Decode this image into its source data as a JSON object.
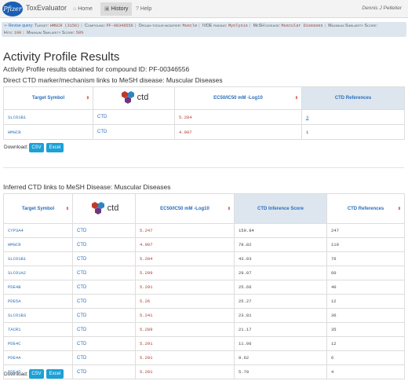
{
  "navbar": {
    "logo_text": "Pfizer",
    "brand": "ToxEvaluator",
    "items": [
      {
        "icon": "home-icon",
        "glyph": "⌂",
        "label": "Home"
      },
      {
        "icon": "history-icon",
        "glyph": "▣",
        "label": "History"
      },
      {
        "icon": "help-icon",
        "glyph": "?",
        "label": "Help"
      }
    ],
    "user": "Dennis J Pelletier"
  },
  "query": {
    "revise_label": "Revise query:",
    "target_key": "Target:",
    "target_value": "HMGCR (3156)",
    "compound_key": "Compound:",
    "compound_value": "PF-00346556",
    "organ_key": "Organ-tissue-modifier:",
    "organ_value": "Muscle",
    "ivde_key": "IVDE finding:",
    "ivde_value": "Myolysis",
    "mesh_key": "MeSH disease:",
    "mesh_value": "Muscular Diseases",
    "maxsim_key": "Maximum Similarity Score:",
    "hits_key": "Hits:",
    "hits_value": "100",
    "minsim_key": "Minimum Similarity Score:",
    "minsim_value": "50%"
  },
  "page": {
    "title": "Activity Profile Results",
    "subtitle": "Activity Profile results obtained for compound ID: PF-00346556",
    "direct_heading": "Direct CTD marker/mechanism links to MeSH disease: Muscular Diseases",
    "inferred_heading": "Inferred CTD links to MeSH Disease: Muscular Diseases"
  },
  "ctd_logo_text": "ctd",
  "direct_table": {
    "headers": {
      "target": "Target Symbol",
      "ec50": "EC50/IC50 mM -Log10",
      "refs": "CTD References"
    },
    "rows": [
      {
        "symbol": "SLCO1B1",
        "source": "CTD",
        "ec50": "5.284",
        "refs": "3"
      },
      {
        "symbol": "HMGCR",
        "source": "CTD",
        "ec50": "4.997",
        "refs": "1"
      }
    ]
  },
  "inferred_table": {
    "headers": {
      "target": "Target Symbol",
      "ec50": "EC50/IC50 mM -Log10",
      "score": "CTD Inference Score",
      "refs": "CTD References"
    },
    "rows": [
      {
        "symbol": "CYP3A4",
        "source": "CTD",
        "ec50": "5.247",
        "score": "159.84",
        "refs": "247"
      },
      {
        "symbol": "HMGCR",
        "source": "CTD",
        "ec50": "4.997",
        "score": "78.82",
        "refs": "119"
      },
      {
        "symbol": "SLCO1B1",
        "source": "CTD",
        "ec50": "5.284",
        "score": "43.03",
        "refs": "76"
      },
      {
        "symbol": "SLCO1A2",
        "source": "CTD",
        "ec50": "5.299",
        "score": "29.07",
        "refs": "60"
      },
      {
        "symbol": "PDE4B",
        "source": "CTD",
        "ec50": "5.291",
        "score": "25.66",
        "refs": "40"
      },
      {
        "symbol": "PDE5A",
        "source": "CTD",
        "ec50": "5.26",
        "score": "25.27",
        "refs": "12"
      },
      {
        "symbol": "SLCO1B3",
        "source": "CTD",
        "ec50": "5.241",
        "score": "23.81",
        "refs": "36"
      },
      {
        "symbol": "TACR1",
        "source": "CTD",
        "ec50": "5.289",
        "score": "21.17",
        "refs": "35"
      },
      {
        "symbol": "PDE4C",
        "source": "CTD",
        "ec50": "5.291",
        "score": "11.06",
        "refs": "12"
      },
      {
        "symbol": "PDE4A",
        "source": "CTD",
        "ec50": "5.291",
        "score": "9.62",
        "refs": "6"
      },
      {
        "symbol": "PDE4D",
        "source": "CTD",
        "ec50": "5.291",
        "score": "5.79",
        "refs": "4"
      }
    ]
  },
  "download": {
    "label": "Download:",
    "csv": "CSV",
    "excel": "Excel"
  },
  "colors": {
    "brand_blue": "#1a5fb4",
    "link": "#2a6ebb",
    "value_red": "#b03a2e",
    "button": "#1ba1d6",
    "sorted_header": "#dde6ee"
  }
}
